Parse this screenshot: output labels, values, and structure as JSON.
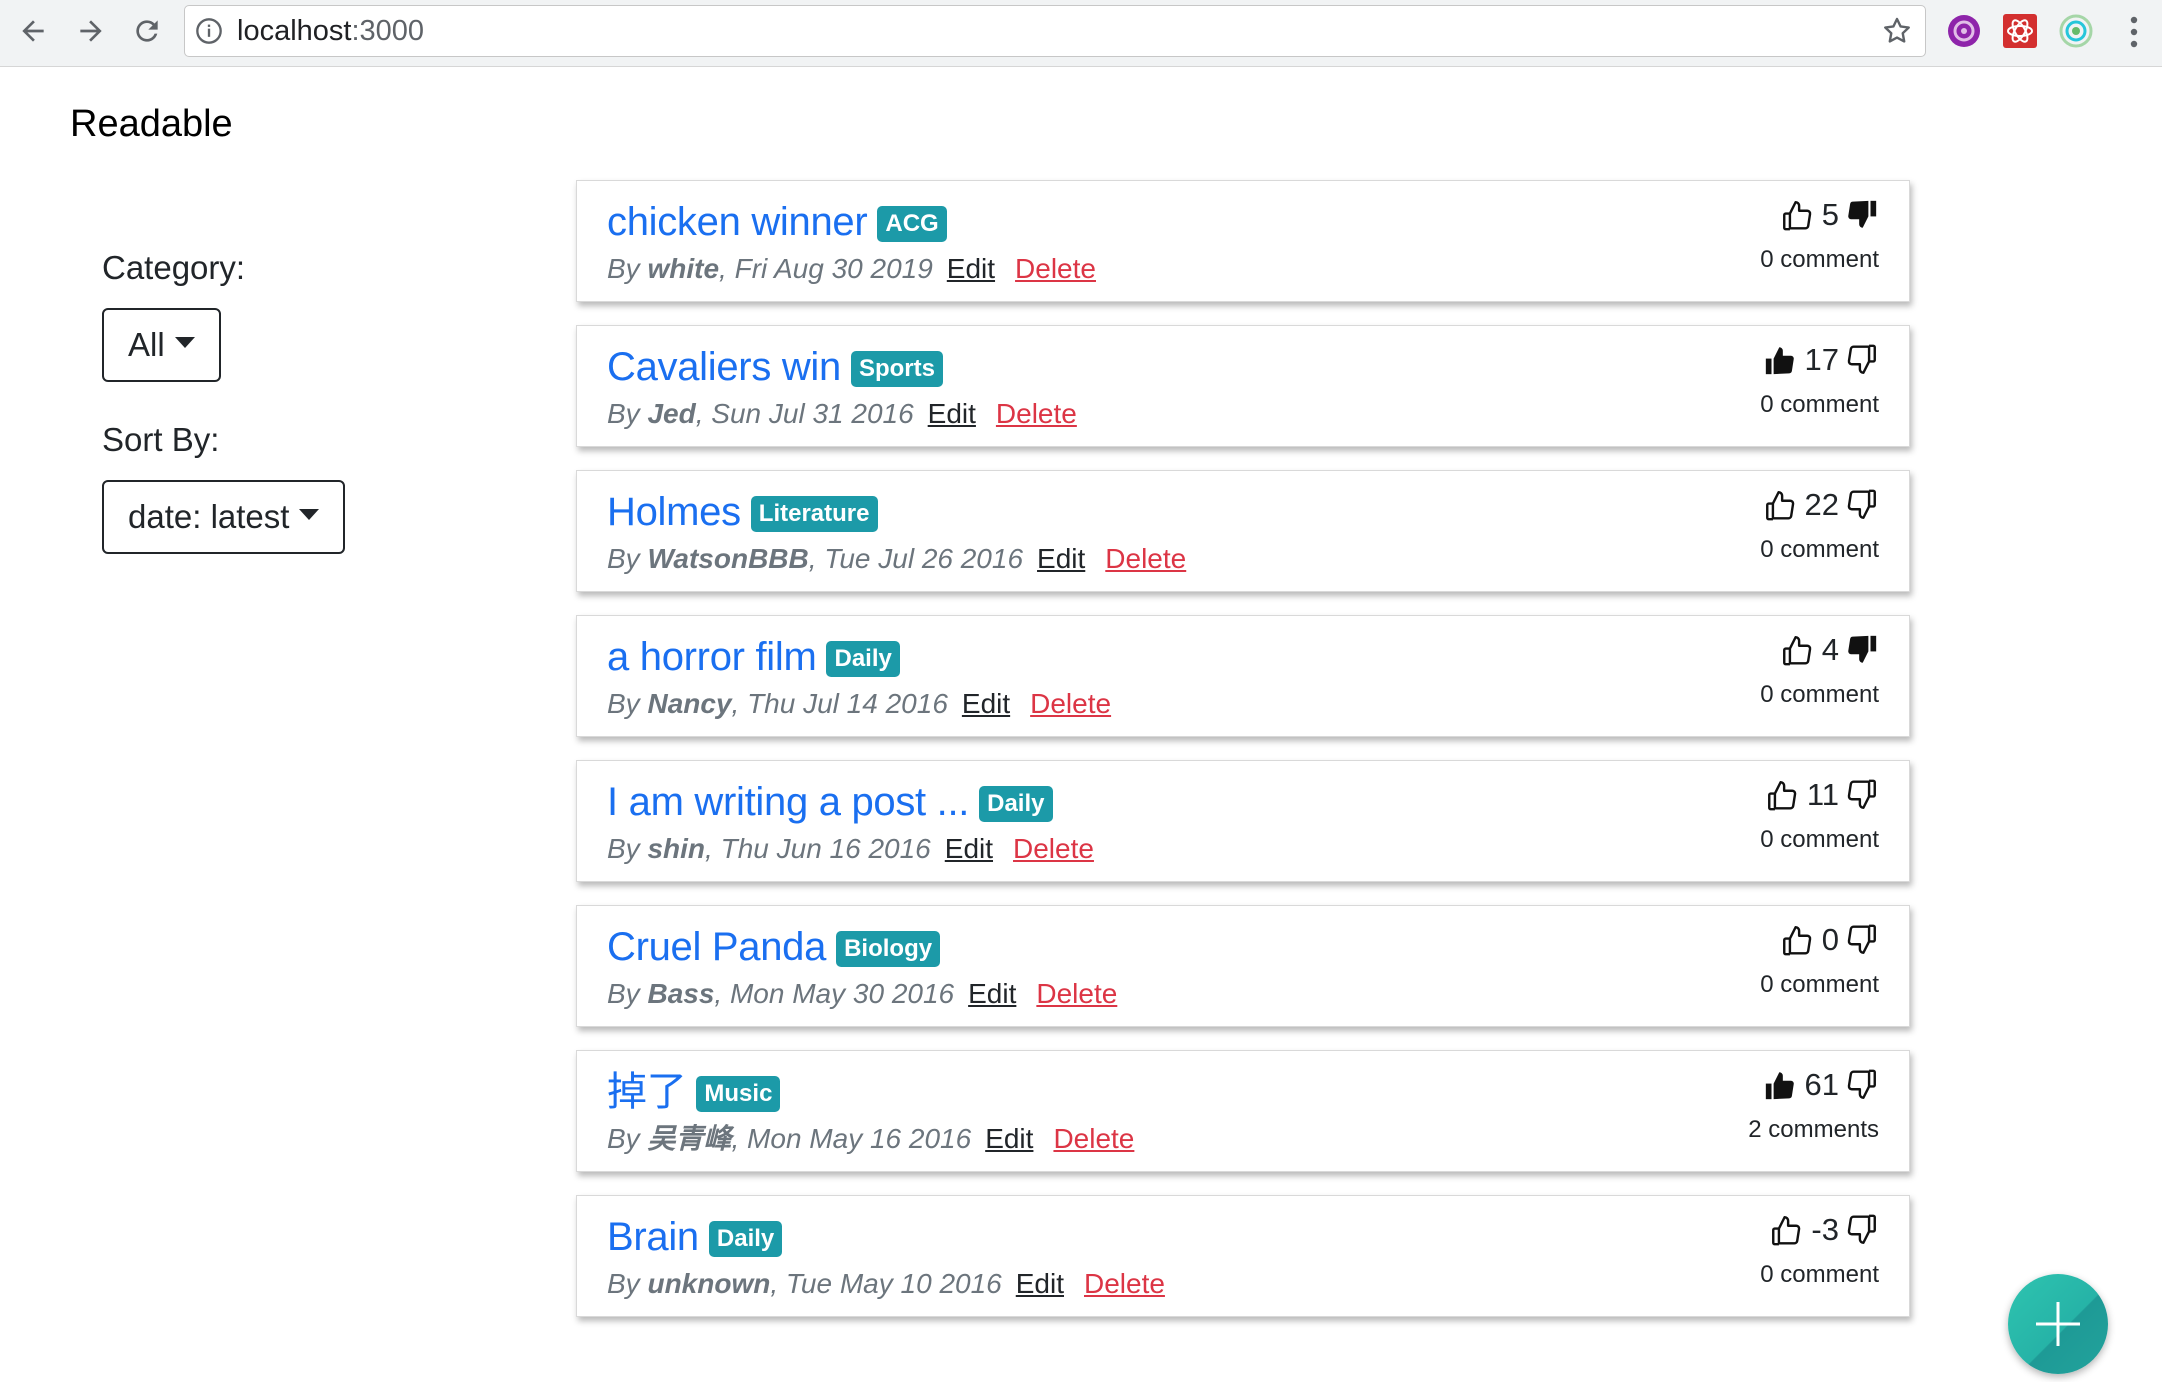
{
  "browser": {
    "url_host": "localhost",
    "url_port": ":3000",
    "icons": [
      "back-icon",
      "forward-icon",
      "reload-icon",
      "info-icon",
      "bookmark-star-icon",
      "extension-purple-icon",
      "extension-redux-icon",
      "extension-green-icon",
      "menu-dots-icon"
    ]
  },
  "app": {
    "title": "Readable"
  },
  "filters": {
    "category_label": "Category:",
    "category_value": "All",
    "sort_label": "Sort By:",
    "sort_value": "date: latest"
  },
  "posts": [
    {
      "title": "chicken winner",
      "category": "ACG",
      "author": "white",
      "date": ", Fri Aug 30 2019",
      "edit": "Edit",
      "delete": "Delete",
      "score": "5",
      "voted": "down",
      "comments": "0 comment"
    },
    {
      "title": "Cavaliers win",
      "category": "Sports",
      "author": "Jed",
      "date": ", Sun Jul 31 2016",
      "edit": "Edit",
      "delete": "Delete",
      "score": "17",
      "voted": "up",
      "comments": "0 comment"
    },
    {
      "title": "Holmes",
      "category": "Literature",
      "author": "WatsonBBB",
      "date": ", Tue Jul 26 2016",
      "edit": "Edit",
      "delete": "Delete",
      "score": "22",
      "voted": "none",
      "comments": "0 comment"
    },
    {
      "title": "a horror film",
      "category": "Daily",
      "author": "Nancy",
      "date": ", Thu Jul 14 2016",
      "edit": "Edit",
      "delete": "Delete",
      "score": "4",
      "voted": "down",
      "comments": "0 comment"
    },
    {
      "title": "I am writing a post ...",
      "category": "Daily",
      "author": "shin",
      "date": ", Thu Jun 16 2016",
      "edit": "Edit",
      "delete": "Delete",
      "score": "11",
      "voted": "none",
      "comments": "0 comment"
    },
    {
      "title": "Cruel Panda",
      "category": "Biology",
      "author": "Bass",
      "date": ", Mon May 30 2016",
      "edit": "Edit",
      "delete": "Delete",
      "score": "0",
      "voted": "none",
      "comments": "0 comment"
    },
    {
      "title": "掉了",
      "category": "Music",
      "author": "吴青峰",
      "date": ", Mon May 16 2016",
      "edit": "Edit",
      "delete": "Delete",
      "score": "61",
      "voted": "up",
      "comments": "2 comments"
    },
    {
      "title": "Brain",
      "category": "Daily",
      "author": "unknown",
      "date": ", Tue May 10 2016",
      "edit": "Edit",
      "delete": "Delete",
      "score": "-3",
      "voted": "none",
      "comments": "0 comment"
    }
  ],
  "colors": {
    "link": "#1a6ff0",
    "badge": "#1c9aa8",
    "delete": "#dc3545",
    "fab": "#26b3a7"
  },
  "fab": {
    "icon": "plus-icon"
  }
}
